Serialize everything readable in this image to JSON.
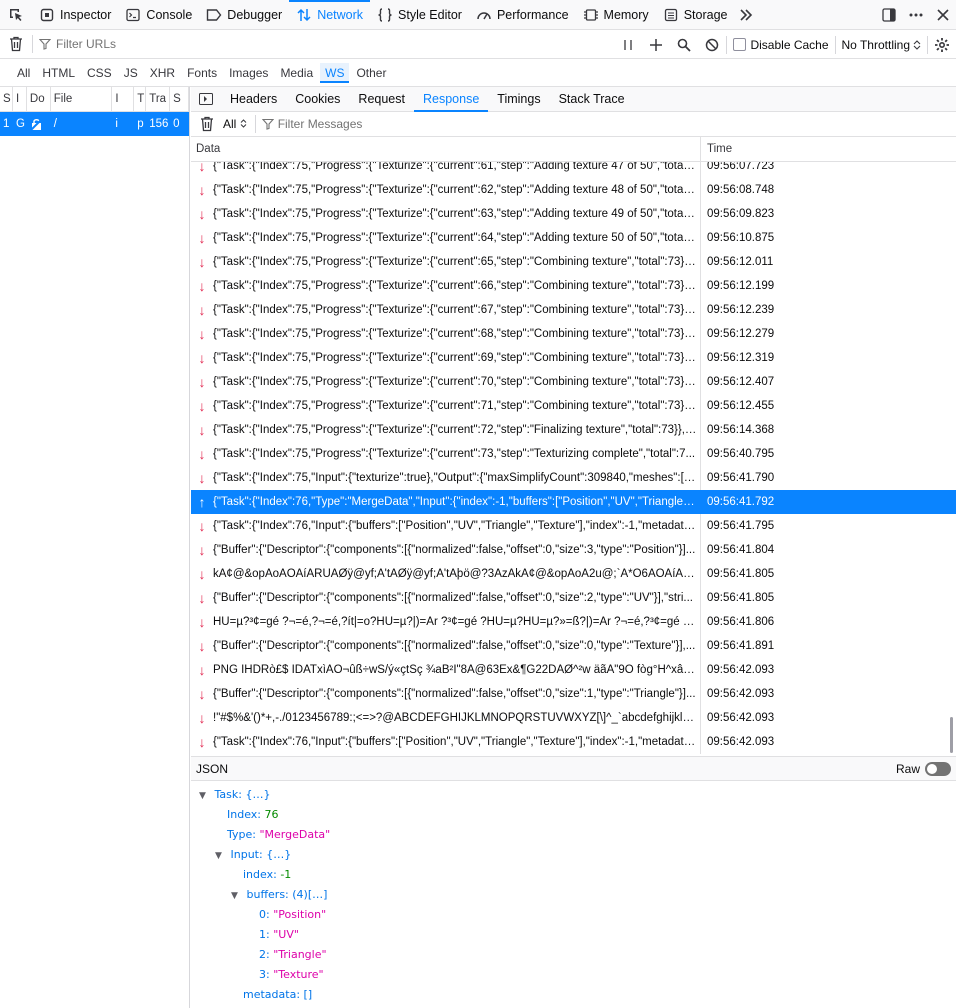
{
  "toolbox": {
    "tabs": [
      {
        "label": "Inspector",
        "icon": "inspector-icon"
      },
      {
        "label": "Console",
        "icon": "console-icon"
      },
      {
        "label": "Debugger",
        "icon": "debugger-icon"
      },
      {
        "label": "Network",
        "icon": "network-icon",
        "active": true
      },
      {
        "label": "Style Editor",
        "icon": "style-editor-icon"
      },
      {
        "label": "Performance",
        "icon": "performance-icon"
      },
      {
        "label": "Memory",
        "icon": "memory-icon"
      },
      {
        "label": "Storage",
        "icon": "storage-icon"
      }
    ]
  },
  "net_toolbar": {
    "filter_placeholder": "Filter URLs",
    "disable_cache_label": "Disable Cache",
    "throttling_value": "No Throttling"
  },
  "type_filters": [
    "All",
    "HTML",
    "CSS",
    "JS",
    "XHR",
    "Fonts",
    "Images",
    "Media",
    "WS",
    "Other"
  ],
  "request_list": {
    "headers": [
      "S",
      "I",
      "Do",
      "File",
      "I",
      "T",
      "Tra",
      "S"
    ],
    "row": [
      "1",
      "G",
      "",
      "/",
      "i",
      "p",
      "156",
      "0"
    ]
  },
  "details": {
    "tabs": [
      "Headers",
      "Cookies",
      "Request",
      "Response",
      "Timings",
      "Stack Trace"
    ],
    "active_tab": "Response",
    "message_filter_type": "All",
    "filter_messages_placeholder": "Filter Messages",
    "columns": [
      "Data",
      "Time"
    ],
    "messages": [
      {
        "dir": "received",
        "data": "{\"Task\":{\"Index\":75,\"Progress\":{\"Texturize\":{\"current\":61,\"step\":\"Adding texture 47 of 50\",\"total\"...",
        "time": "09:56:07.723"
      },
      {
        "dir": "received",
        "data": "{\"Task\":{\"Index\":75,\"Progress\":{\"Texturize\":{\"current\":62,\"step\":\"Adding texture 48 of 50\",\"total\"...",
        "time": "09:56:08.748"
      },
      {
        "dir": "received",
        "data": "{\"Task\":{\"Index\":75,\"Progress\":{\"Texturize\":{\"current\":63,\"step\":\"Adding texture 49 of 50\",\"total\"...",
        "time": "09:56:09.823"
      },
      {
        "dir": "received",
        "data": "{\"Task\":{\"Index\":75,\"Progress\":{\"Texturize\":{\"current\":64,\"step\":\"Adding texture 50 of 50\",\"total\"...",
        "time": "09:56:10.875"
      },
      {
        "dir": "received",
        "data": "{\"Task\":{\"Index\":75,\"Progress\":{\"Texturize\":{\"current\":65,\"step\":\"Combining texture\",\"total\":73}},...",
        "time": "09:56:12.011"
      },
      {
        "dir": "received",
        "data": "{\"Task\":{\"Index\":75,\"Progress\":{\"Texturize\":{\"current\":66,\"step\":\"Combining texture\",\"total\":73}},...",
        "time": "09:56:12.199"
      },
      {
        "dir": "received",
        "data": "{\"Task\":{\"Index\":75,\"Progress\":{\"Texturize\":{\"current\":67,\"step\":\"Combining texture\",\"total\":73}},...",
        "time": "09:56:12.239"
      },
      {
        "dir": "received",
        "data": "{\"Task\":{\"Index\":75,\"Progress\":{\"Texturize\":{\"current\":68,\"step\":\"Combining texture\",\"total\":73}},...",
        "time": "09:56:12.279"
      },
      {
        "dir": "received",
        "data": "{\"Task\":{\"Index\":75,\"Progress\":{\"Texturize\":{\"current\":69,\"step\":\"Combining texture\",\"total\":73}},...",
        "time": "09:56:12.319"
      },
      {
        "dir": "received",
        "data": "{\"Task\":{\"Index\":75,\"Progress\":{\"Texturize\":{\"current\":70,\"step\":\"Combining texture\",\"total\":73}},...",
        "time": "09:56:12.407"
      },
      {
        "dir": "received",
        "data": "{\"Task\":{\"Index\":75,\"Progress\":{\"Texturize\":{\"current\":71,\"step\":\"Combining texture\",\"total\":73}},...",
        "time": "09:56:12.455"
      },
      {
        "dir": "received",
        "data": "{\"Task\":{\"Index\":75,\"Progress\":{\"Texturize\":{\"current\":72,\"step\":\"Finalizing texture\",\"total\":73}},\"...",
        "time": "09:56:14.368"
      },
      {
        "dir": "received",
        "data": "{\"Task\":{\"Index\":75,\"Progress\":{\"Texturize\":{\"current\":73,\"step\":\"Texturizing complete\",\"total\":7...",
        "time": "09:56:40.795"
      },
      {
        "dir": "received",
        "data": "{\"Task\":{\"Index\":75,\"Input\":{\"texturize\":true},\"Output\":{\"maxSimplifyCount\":309840,\"meshes\":[{...",
        "time": "09:56:41.790"
      },
      {
        "dir": "sent",
        "selected": true,
        "data": "{\"Task\":{\"Index\":76,\"Type\":\"MergeData\",\"Input\":{\"index\":-1,\"buffers\":[\"Position\",\"UV\",\"Triangle\",...",
        "time": "09:56:41.792"
      },
      {
        "dir": "received",
        "data": "{\"Task\":{\"Index\":76,\"Input\":{\"buffers\":[\"Position\",\"UV\",\"Triangle\",\"Texture\"],\"index\":-1,\"metadata...",
        "time": "09:56:41.795"
      },
      {
        "dir": "received",
        "data": "{\"Buffer\":{\"Descriptor\":{\"components\":[{\"normalized\":false,\"offset\":0,\"size\":3,\"type\":\"Position\"}]...",
        "time": "09:56:41.804"
      },
      {
        "dir": "received",
        "data": "kÁ¢@&opAoAOAíARÜAØÿ@yf;A'tAØÿ@yf;A'tAþö@?3AzAkÁ¢@&opAoA2u@;`A*O6AOAíARÜA...",
        "time": "09:56:41.805"
      },
      {
        "dir": "received",
        "data": "{\"Buffer\":{\"Descriptor\":{\"components\":[{\"normalized\":false,\"offset\":0,\"size\":2,\"type\":\"UV\"}],\"stri...",
        "time": "09:56:41.805"
      },
      {
        "dir": "received",
        "data": "HÜ=µ?³¢=gé ?¬=é,?¬=é,?ít|=o?HÜ=µ?|)=Ar ?³¢=gé ?HÜ=µ?HÜ=µ?»=ß?|)=Ar ?¬=é,?³¢=gé ?|)=...",
        "time": "09:56:41.806"
      },
      {
        "dir": "received",
        "data": "{\"Buffer\":{\"Descriptor\":{\"components\":[{\"normalized\":false,\"offset\":0,\"size\":0,\"type\":\"Texture\"}],...",
        "time": "09:56:41.891"
      },
      {
        "dir": "received",
        "data": "PNG  IHDRò£$ IDATxìÁO¬ûß÷wS/ý«çtSç ¾aB²Ì\"8Ä@63Ëx&¶G22DÁØ^²w äãÀ\"9Ò fòg°H^xâ@V°...",
        "time": "09:56:42.093"
      },
      {
        "dir": "received",
        "data": "{\"Buffer\":{\"Descriptor\":{\"components\":[{\"normalized\":false,\"offset\":0,\"size\":1,\"type\":\"Triangle\"}]...",
        "time": "09:56:42.093"
      },
      {
        "dir": "received",
        "data": "  !\"#$%&'()*+,-./0123456789:;<=>?@ABCDEFGHIJKLMNOPQRSTUVWXYZ[\\]^_`abcdefghijklmno...",
        "time": "09:56:42.093"
      },
      {
        "dir": "received",
        "data": "{\"Task\":{\"Index\":76,\"Input\":{\"buffers\":[\"Position\",\"UV\",\"Triangle\",\"Texture\"],\"index\":-1,\"metadata...",
        "time": "09:56:42.093"
      }
    ],
    "json_panel": {
      "title": "JSON",
      "raw_label": "Raw",
      "raw_enabled": false,
      "task_label": "Task:",
      "task_summary": "{…}",
      "index_key": "Index:",
      "index_value": "76",
      "type_key": "Type:",
      "type_value": "\"MergeData\"",
      "input_key": "Input:",
      "input_summary": "{…}",
      "input_index_key": "index:",
      "input_index_value": "-1",
      "buffers_key": "buffers:",
      "buffers_summary": "(4)[…]",
      "buffers": [
        {
          "k": "0:",
          "v": "\"Position\""
        },
        {
          "k": "1:",
          "v": "\"UV\""
        },
        {
          "k": "2:",
          "v": "\"Triangle\""
        },
        {
          "k": "3:",
          "v": "\"Texture\""
        }
      ],
      "metadata_key": "metadata:",
      "metadata_value": "[]"
    }
  }
}
